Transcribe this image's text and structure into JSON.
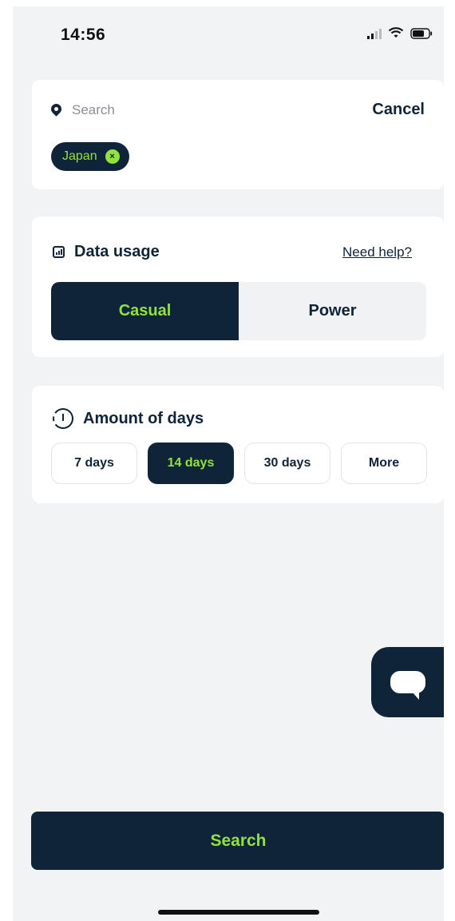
{
  "status_bar": {
    "time": "14:56"
  },
  "search": {
    "placeholder": "Search",
    "cancel_label": "Cancel",
    "chip_label": "Japan",
    "chip_close_icon": "×"
  },
  "data_usage": {
    "title": "Data usage",
    "help_label": "Need help?",
    "options": [
      {
        "label": "Casual",
        "selected": true
      },
      {
        "label": "Power",
        "selected": false
      }
    ]
  },
  "days": {
    "title": "Amount of days",
    "options": [
      {
        "label": "7 days",
        "selected": false
      },
      {
        "label": "14 days",
        "selected": true
      },
      {
        "label": "30 days",
        "selected": false
      },
      {
        "label": "More",
        "selected": false
      }
    ]
  },
  "search_button_label": "Search",
  "colors": {
    "navy": "#0f2438",
    "accent_green": "#8fe33b",
    "background": "#f2f3f5"
  },
  "icons": [
    "location-pin-icon",
    "chart-icon",
    "timer-icon",
    "chat-bubble-icon",
    "signal-icon",
    "wifi-icon",
    "battery-icon"
  ]
}
